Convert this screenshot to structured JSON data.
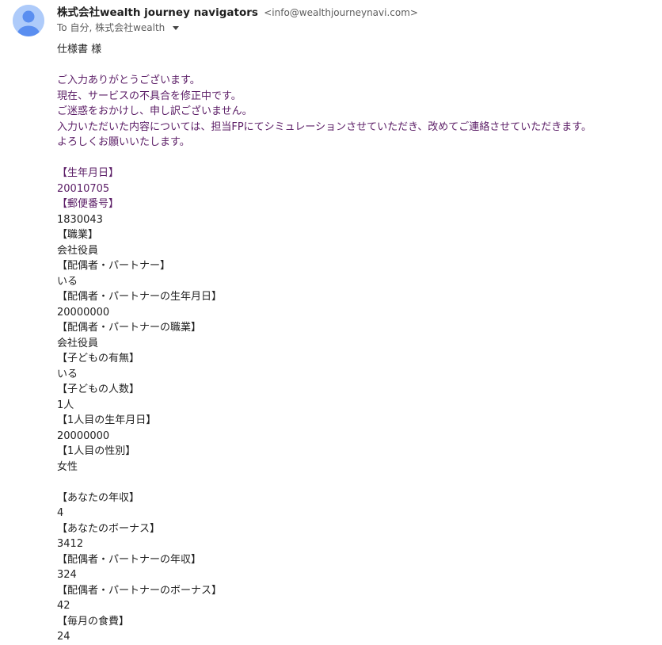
{
  "sender": {
    "name": "株式会社wealth journey navigators",
    "email": "<info@wealthjourneynavi.com>",
    "recipients": "To 自分, 株式会社wealth"
  },
  "greeting": "仕様書 様",
  "message": [
    "ご入力ありがとうございます。",
    "現在、サービスの不具合を修正中です。",
    "ご迷惑をおかけし、申し訳ございません。",
    "入力いただいた内容については、担当FPにてシミュレーションさせていただき、改めてご連絡させていただきます。",
    "よろしくお願いいたします。"
  ],
  "fields1": [
    {
      "label": "【生年月日】",
      "value": "20010705"
    },
    {
      "label": "【郵便番号】",
      "value": "1830043"
    },
    {
      "label": "【職業】",
      "value": "会社役員"
    },
    {
      "label": "【配偶者・パートナー】",
      "value": "いる"
    },
    {
      "label": "【配偶者・パートナーの生年月日】",
      "value": "20000000"
    },
    {
      "label": "【配偶者・パートナーの職業】",
      "value": "会社役員"
    },
    {
      "label": "【子どもの有無】",
      "value": "いる"
    },
    {
      "label": "【子どもの人数】",
      "value": "1人"
    },
    {
      "label": "【1人目の生年月日】",
      "value": "20000000"
    },
    {
      "label": "【1人目の性別】",
      "value": "女性"
    }
  ],
  "fields2": [
    {
      "label": "【あなたの年収】",
      "value": "4"
    },
    {
      "label": "【あなたのボーナス】",
      "value": "3412"
    },
    {
      "label": "【配偶者・パートナーの年収】",
      "value": "324"
    },
    {
      "label": "【配偶者・パートナーのボーナス】",
      "value": "42"
    },
    {
      "label": "【毎月の食費】",
      "value": "24"
    }
  ],
  "colors": {
    "quoted_text": "#5b1d66",
    "body_text": "#222222",
    "avatar_bg": "#aecbfa",
    "avatar_fg": "#5a8ef0"
  },
  "icons": {
    "avatar": "person-icon",
    "recipients_toggle": "chevron-down-icon"
  }
}
